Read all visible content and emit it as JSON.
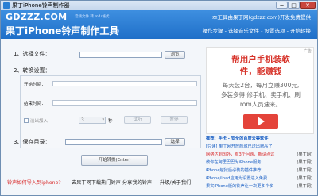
{
  "window": {
    "title": "果丁iPhone铃声制作器",
    "min": "─",
    "max": "□",
    "close": "✕"
  },
  "header": {
    "logo": "GDZZZ.COM",
    "tagline": "音频文件 转 m4r格式",
    "app_title": "果丁iPhone铃声制作工具",
    "version": "1.9",
    "provider": "本工具由果丁网(gdzzz.com)开发免费提供",
    "nav": "操作步骤 - 选择音乐文件 - 设置选项 - 开始转换"
  },
  "step1": {
    "label": "1、选择文件：",
    "file_value": "",
    "browse_label": "浏览"
  },
  "step2": {
    "label": "2、转换设置：",
    "start_label": "开始时间：",
    "end_label": "结束时间：",
    "fade_label": "淡出加入",
    "fade_value": "3",
    "seconds_label": "秒",
    "preview_label": "试听",
    "pause_label": "暂停"
  },
  "step3": {
    "label": "3、保存目录：",
    "dir_value": "",
    "choose_label": "选择"
  },
  "start_button": "开始转换(Enter)",
  "links": {
    "red": "铃声如何导入到iphone?",
    "items": [
      "去果丁网下载热门铃声",
      "分享我的铃声",
      "升级/关于我们"
    ]
  },
  "ad": {
    "badge": "广告",
    "headline1": "帮用户手机装软",
    "headline2": "件，能赚钱",
    "line1": "每天装2台，每月立赚300元,",
    "line2": "多装多得  修手机、卖手机、刷",
    "line3": "rom人员速来。"
  },
  "right_links": [
    {
      "text": "推荐：手卡 - 安全的百度云等软件",
      "source": "",
      "highlight": false,
      "bold": true
    },
    {
      "text": "[只读] 果丁网开放商城已送出赠品了",
      "source": "",
      "highlight": false
    },
    {
      "text": "网络达到国外，有3个问题，新请点这",
      "source": "(果丁网)",
      "highlight": true
    },
    {
      "text": "教你在阿里巴巴为iPhone服务",
      "source": "(果丁网)",
      "highlight": false
    },
    {
      "text": "iPhone越狱后必装的插件推荐",
      "source": "(果丁网)",
      "highlight": false
    },
    {
      "text": "iPhone/ipad应用为设置进入免费",
      "source": "(果丁网)",
      "highlight": false
    },
    {
      "text": "果实iPhone版的铃声让一次更多个多",
      "source": "(果丁网)",
      "highlight": false
    }
  ],
  "colors": {
    "header": "#2a7fd4",
    "accent_red": "#d92a2a",
    "link": "#1a5fc4"
  }
}
